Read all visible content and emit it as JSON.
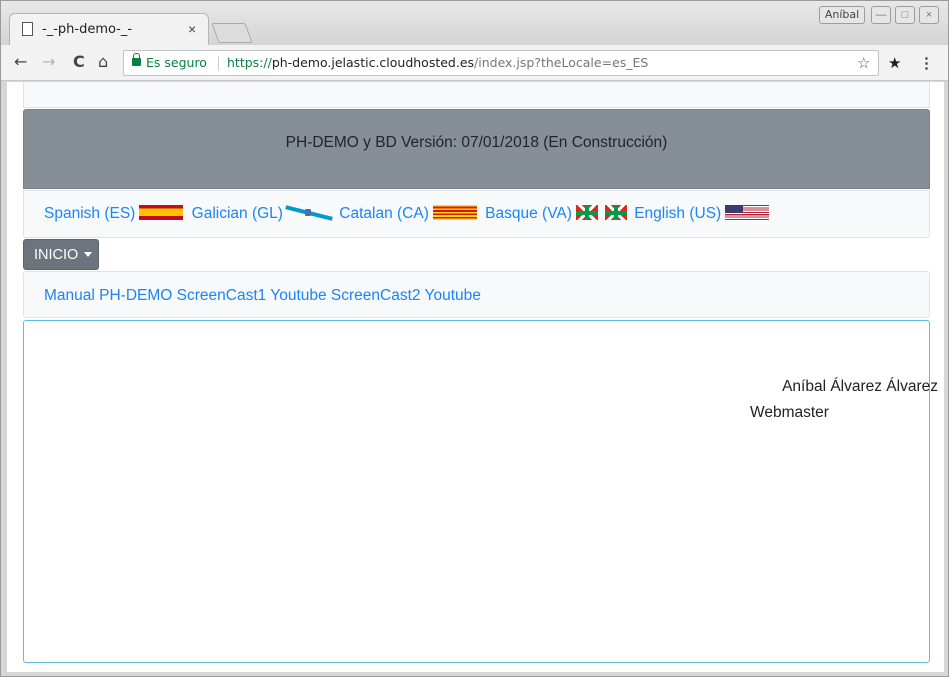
{
  "browser": {
    "tab_title": "-_-ph-demo-_-",
    "tab_close": "×",
    "user_name": "Aníbal",
    "win_minimize": "—",
    "win_maximize": "□",
    "win_close": "×",
    "back": "←",
    "forward": "→",
    "reload": "C",
    "home": "⌂",
    "secure_label": "Es seguro",
    "url_scheme": "https://",
    "url_host": "ph-demo.jelastic.cloudhosted.es",
    "url_path": "/index.jsp?theLocale=es_ES",
    "bookmark_star": "☆",
    "extension_star": "★",
    "menu": "⋮"
  },
  "page": {
    "header": "PH-DEMO y BD Versión: 07/01/2018 (En Construcción)",
    "languages": [
      {
        "label": "Spanish (ES)",
        "flag": "flag-es"
      },
      {
        "label": "Galician (GL)",
        "flag": "flag-gl"
      },
      {
        "label": "Catalan (CA)",
        "flag": "flag-ca"
      },
      {
        "label": "Basque (VA)",
        "flag": "flag-eu"
      },
      {
        "label": "English (US)",
        "flag": "flag-us"
      }
    ],
    "inicio_label": "INICIO",
    "links": [
      "Manual PH-DEMO",
      "ScreenCast1 Youtube",
      "ScreenCast2 Youtube"
    ],
    "footer_name": "Aníbal Álvarez Álvarez",
    "footer_role": "Webmaster"
  },
  "colors": {
    "link": "#1a85f5",
    "banner": "#868e96",
    "secure": "#0b8043",
    "content_border": "#5bc0de"
  }
}
